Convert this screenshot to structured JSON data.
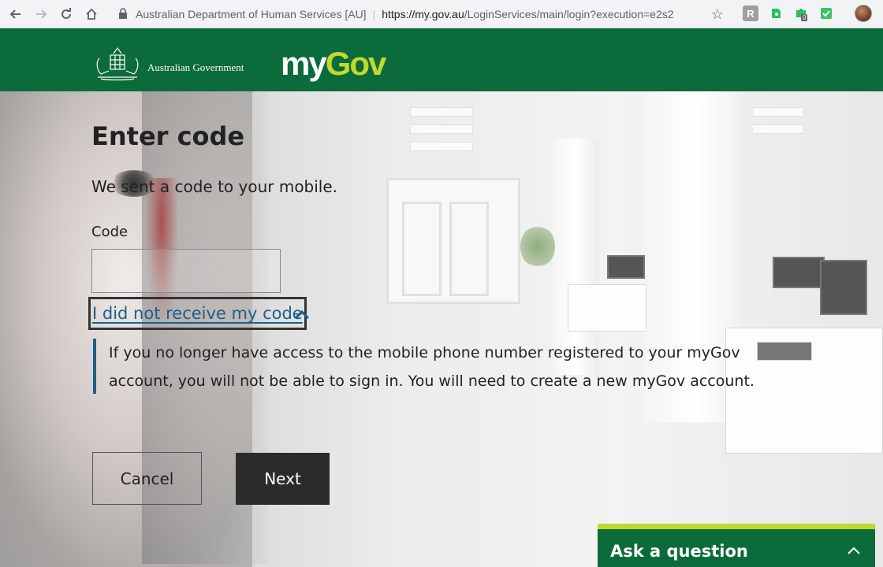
{
  "browser": {
    "page_title": "Australian Department of Human Services [AU]",
    "url_host": "https://my.gov.au",
    "url_path": "/LoginServices/main/login?execution=e2s2",
    "separator": "|",
    "extension_badge": "0",
    "icons": {
      "back": "back-arrow-icon",
      "forward": "forward-arrow-icon",
      "reload": "reload-icon",
      "home": "home-icon",
      "lock": "lock-icon",
      "star": "star-icon"
    }
  },
  "header": {
    "gov_name": "Australian Government",
    "logo_my": "my",
    "logo_gov": "Gov",
    "colors": {
      "background": "#0b6b3a",
      "accent": "#c1d82f"
    }
  },
  "form": {
    "title": "Enter code",
    "subtitle": "We sent a code to your mobile.",
    "code_label": "Code",
    "code_value": "",
    "help_link": "I did not receive my code",
    "info_line1": "If you no longer have access to the mobile phone number registered to your myGov",
    "info_line2": "account, you will not be able to sign in. You will need to create a new myGov account.",
    "cancel_label": "Cancel",
    "next_label": "Next"
  },
  "ask": {
    "label": "Ask a question"
  }
}
